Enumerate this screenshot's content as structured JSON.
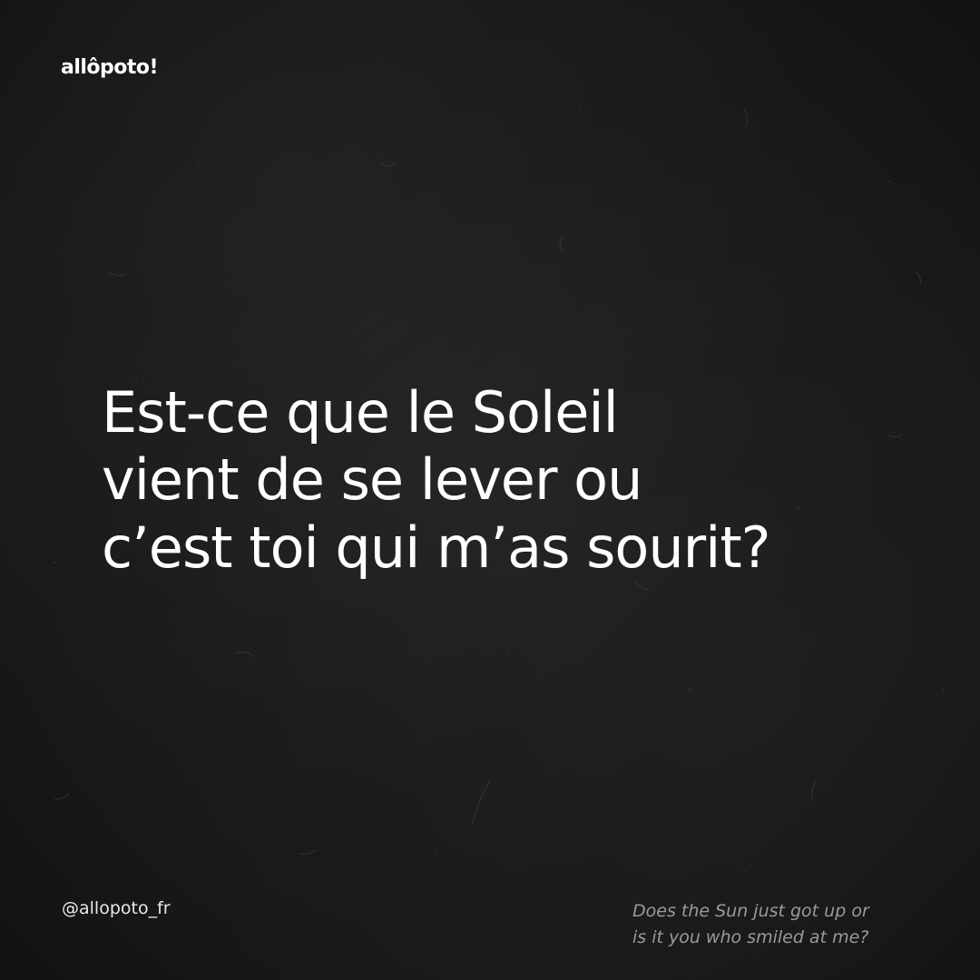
{
  "brand": {
    "logo_text": "allôpoto!"
  },
  "quote": {
    "lines": [
      "Est-ce que le Soleil",
      "vient de se lever ou",
      "c’est toi qui m’as sourit?"
    ]
  },
  "footer": {
    "handle": "@allopoto_fr",
    "translation_lines": [
      "Does the Sun just got up or",
      "is it you who smiled at me?"
    ]
  },
  "colors": {
    "background": "#1a1a1a",
    "text_primary": "#ffffff",
    "text_muted": "#9a9a9a"
  }
}
